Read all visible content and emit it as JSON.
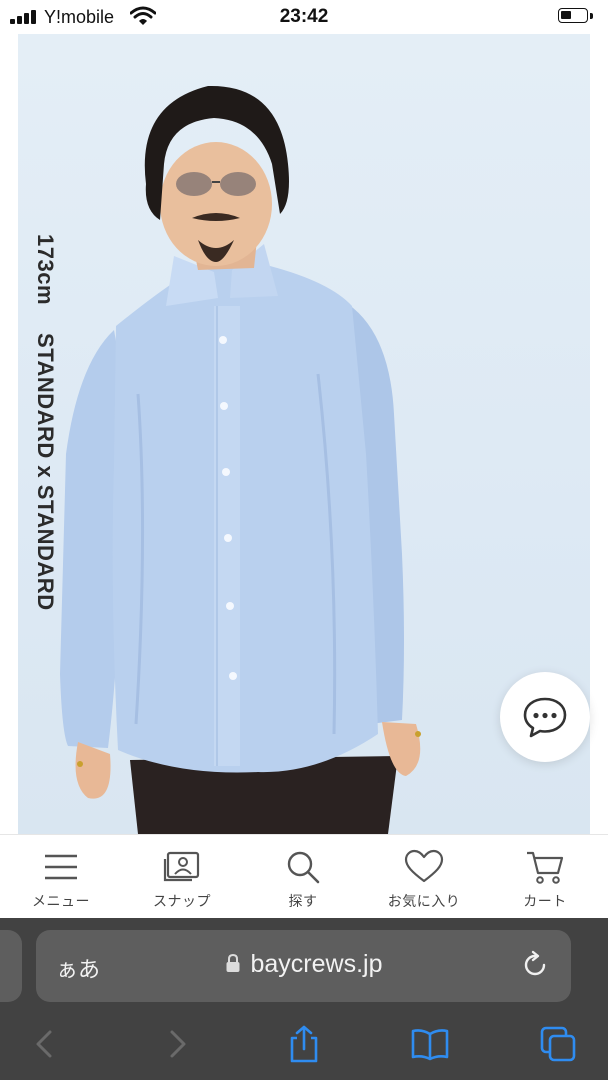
{
  "status_bar": {
    "carrier": "Y!mobile",
    "time": "23:42",
    "icons": [
      "signal-icon",
      "wifi-icon",
      "battery-icon"
    ]
  },
  "product": {
    "side_caption_height": "173cm",
    "side_caption_brand": "STANDARD x STANDARD"
  },
  "chat": {
    "icon": "chat-bubble-icon"
  },
  "bottom_nav": {
    "items": [
      {
        "label": "メニュー",
        "icon": "menu-icon"
      },
      {
        "label": "スナップ",
        "icon": "snap-camera-icon"
      },
      {
        "label": "探す",
        "icon": "search-icon"
      },
      {
        "label": "お気に入り",
        "icon": "heart-icon"
      },
      {
        "label": "カート",
        "icon": "cart-icon"
      }
    ]
  },
  "browser": {
    "text_size_button": "ぁあ",
    "url": "baycrews.jp",
    "accent_color": "#2f8cf0",
    "toolbar": [
      "back-icon",
      "forward-icon",
      "share-icon",
      "bookmarks-icon",
      "tabs-icon"
    ]
  }
}
